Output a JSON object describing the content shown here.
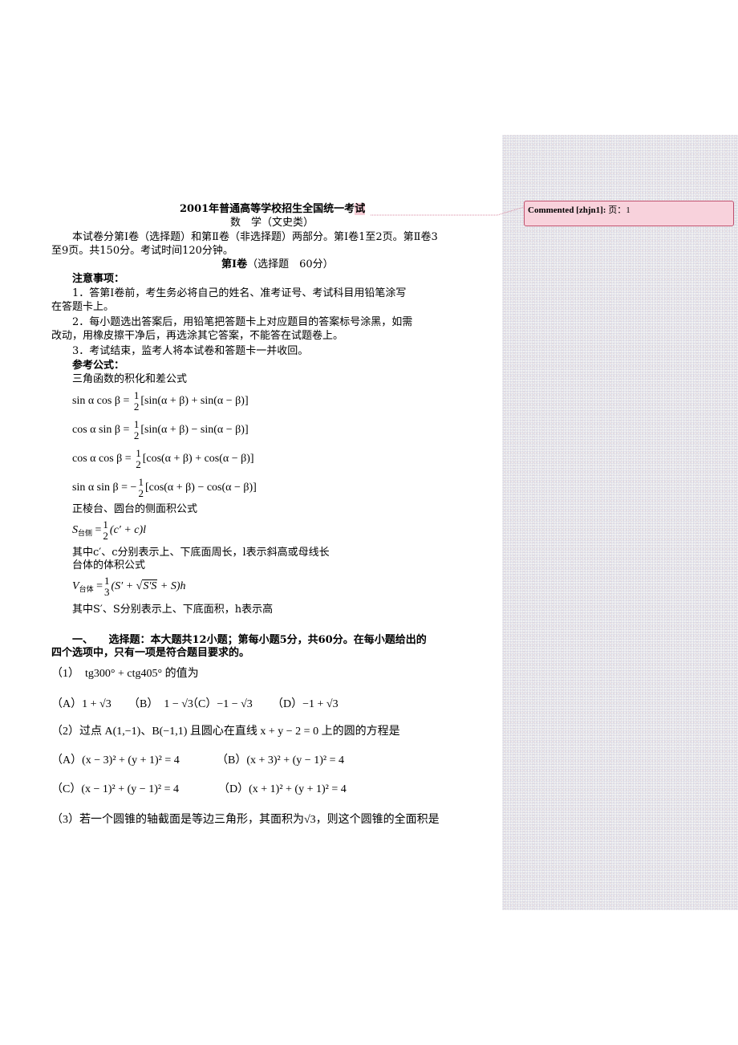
{
  "document": {
    "title": "2001年普通高等学校招生全国统一考",
    "title_highlight": "试",
    "subtitle": "数　学（文史类）",
    "intro_line1": "本试卷分第Ⅰ卷（选择题）和第Ⅱ卷（非选择题）两部分。第Ⅰ卷1至2页。第Ⅱ卷3",
    "intro_line2": "至9页。共150分。考试时间120分钟。",
    "volume_heading_bold": "第Ⅰ卷",
    "volume_heading_rest": "（选择题　60分）",
    "notice_heading": "注意事项：",
    "notices": [
      {
        "line1": "1．答第Ⅰ卷前，考生务必将自己的姓名、准考证号、考试科目用铅笔涂写",
        "line2": "在答题卡上。"
      },
      {
        "line1": "2．每小题选出答案后，用铅笔把答题卡上对应题目的答案标号涂黑，如需",
        "line2": "改动，用橡皮擦干净后，再选涂其它答案，不能答在试题卷上。"
      },
      {
        "line1": "3．考试结束，监考人将本试卷和答题卡一并收回。",
        "line2": ""
      }
    ],
    "formula_heading": "参考公式：",
    "trig_heading": "三角函数的积化和差公式",
    "trig_formulas": [
      {
        "lhs": "sin α cos β =",
        "sign": "",
        "num": "1",
        "den": "2",
        "rhs": "[sin(α + β) + sin(α − β)]"
      },
      {
        "lhs": "cos α sin β =",
        "sign": "",
        "num": "1",
        "den": "2",
        "rhs": "[sin(α + β) − sin(α − β)]"
      },
      {
        "lhs": "cos α cos β =",
        "sign": "",
        "num": "1",
        "den": "2",
        "rhs": "[cos(α + β) + cos(α − β)]"
      },
      {
        "lhs": "sin α sin β =",
        "sign": "−",
        "num": "1",
        "den": "2",
        "rhs": "[cos(α + β) − cos(α − β)]"
      }
    ],
    "frustum_lateral_heading": "正棱台、圆台的侧面积公式",
    "frustum_lateral": {
      "sym": "S",
      "sub": "台侧",
      "eq": "=",
      "num": "1",
      "den": "2",
      "rhs": "(c′ + c)l"
    },
    "frustum_lateral_note": "其中c′、c分别表示上、下底面周长，l表示斜高或母线长",
    "frustum_volume_heading": "台体的体积公式",
    "frustum_volume": {
      "sym": "V",
      "sub": "台体",
      "eq": "=",
      "num": "1",
      "den": "3",
      "rhs_pre": "(S′ + ",
      "sqrt": "S′S",
      "rhs_post": " + S)h"
    },
    "frustum_volume_note": "其中S′、S分别表示上、下底面积，h表示高",
    "section_heading_line1": "一、　　选择题：本大题共12小题；第每小题5分，共60分。在每小题给出的",
    "section_heading_line2": "四个选项中，只有一项是符合题目要求的。",
    "questions": [
      {
        "stem": "（1）　tg300° + ctg405°  的值为",
        "options": [
          "（A）1 + √3",
          "（B）　1 − √3",
          "（C）−1 − √3",
          "（D）−1 + √3"
        ]
      },
      {
        "stem": "（2）过点 A(1,−1)、B(−1,1) 且圆心在直线 x + y − 2 = 0 上的圆的方程是",
        "options": [
          "（A）(x − 3)² + (y + 1)² = 4",
          "（B）(x + 3)² + (y − 1)² = 4",
          "（C）(x − 1)² + (y − 1)² = 4",
          "（D）(x + 1)² + (y + 1)² = 4"
        ]
      },
      {
        "stem": "（3）若一个圆锥的轴截面是等边三角形，其面积为√3，则这个圆锥的全面积是",
        "options": []
      }
    ]
  },
  "comments": [
    {
      "author": "Commented [zhjn1]:",
      "text": "页：1"
    }
  ],
  "colors": {
    "comment_fill": "#f8d2dc",
    "comment_border": "#c0506e",
    "highlight": "#f6cdd6",
    "pane": "#f0f0f0"
  }
}
